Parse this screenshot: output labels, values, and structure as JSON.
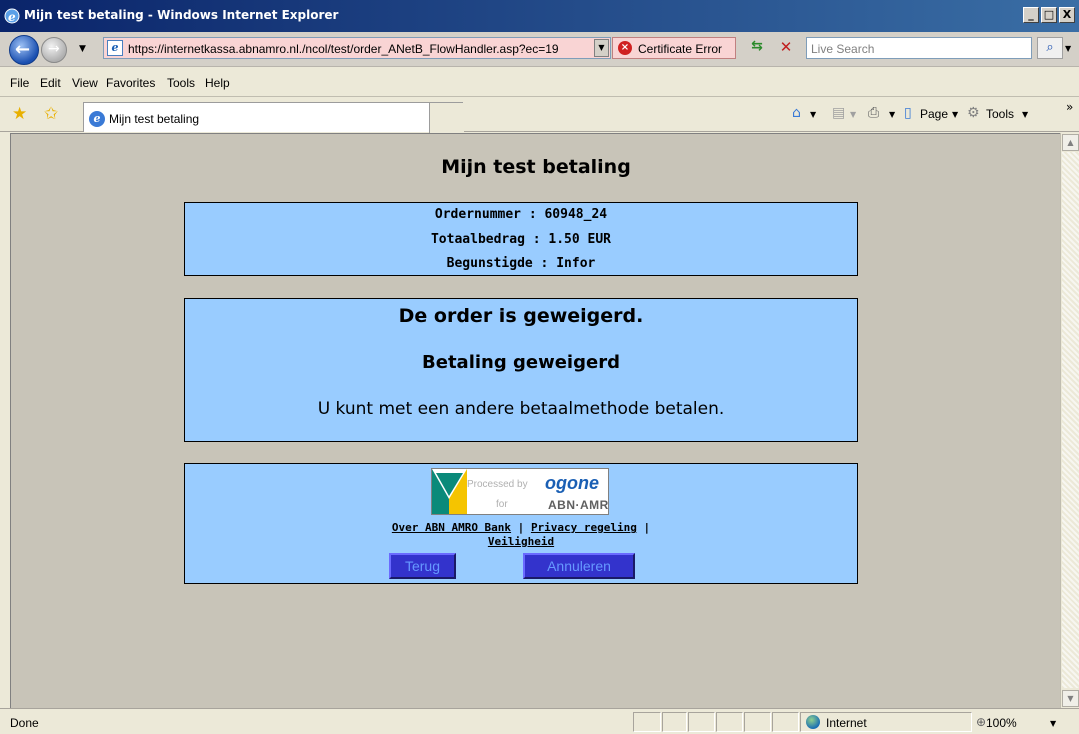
{
  "window": {
    "title": "Mijn test betaling - Windows Internet Explorer",
    "min_glyph": "_",
    "max_glyph": "□",
    "close_glyph": "X"
  },
  "address_bar": {
    "url": "https://internetkassa.abnamro.nl./ncol/test/order_ANetB_FlowHandler.asp?ec=19",
    "cert_error": "Certificate Error",
    "search_placeholder": "Live Search"
  },
  "menu": [
    "File",
    "Edit",
    "View",
    "Favorites",
    "Tools",
    "Help"
  ],
  "tab": {
    "title": "Mijn test betaling"
  },
  "command_bar": {
    "page_label": "Page",
    "tools_label": "Tools"
  },
  "page": {
    "title": "Mijn test betaling",
    "order": {
      "order_number_line": "Ordernummer : 60948_24",
      "total_line": "Totaalbedrag : 1.50 EUR",
      "beneficiary_line": "Begunstigde : Infor"
    },
    "result": {
      "heading": "De order is geweigerd.",
      "subheading": "Betaling geweigerd",
      "message": "U kunt met een andere betaalmethode betalen."
    },
    "footer": {
      "logo_processed_by": "Processed by",
      "logo_ogone": "ogone",
      "logo_for": "for",
      "logo_abn": "ABN·AMRO",
      "link_about": "Over ABN AMRO Bank",
      "link_separator": " | ",
      "link_privacy": "Privacy regeling",
      "link_separator_2": " |",
      "link_security": "Veiligheid",
      "back_button": "Terug",
      "cancel_button": "Annuleren"
    }
  },
  "status_bar": {
    "status": "Done",
    "zone": "Internet",
    "zoom": "100%"
  },
  "colors": {
    "panel_background": "#99ccff",
    "button_background": "#3333cc",
    "button_text": "#6699ff",
    "viewport_background": "#c8c4b8"
  }
}
